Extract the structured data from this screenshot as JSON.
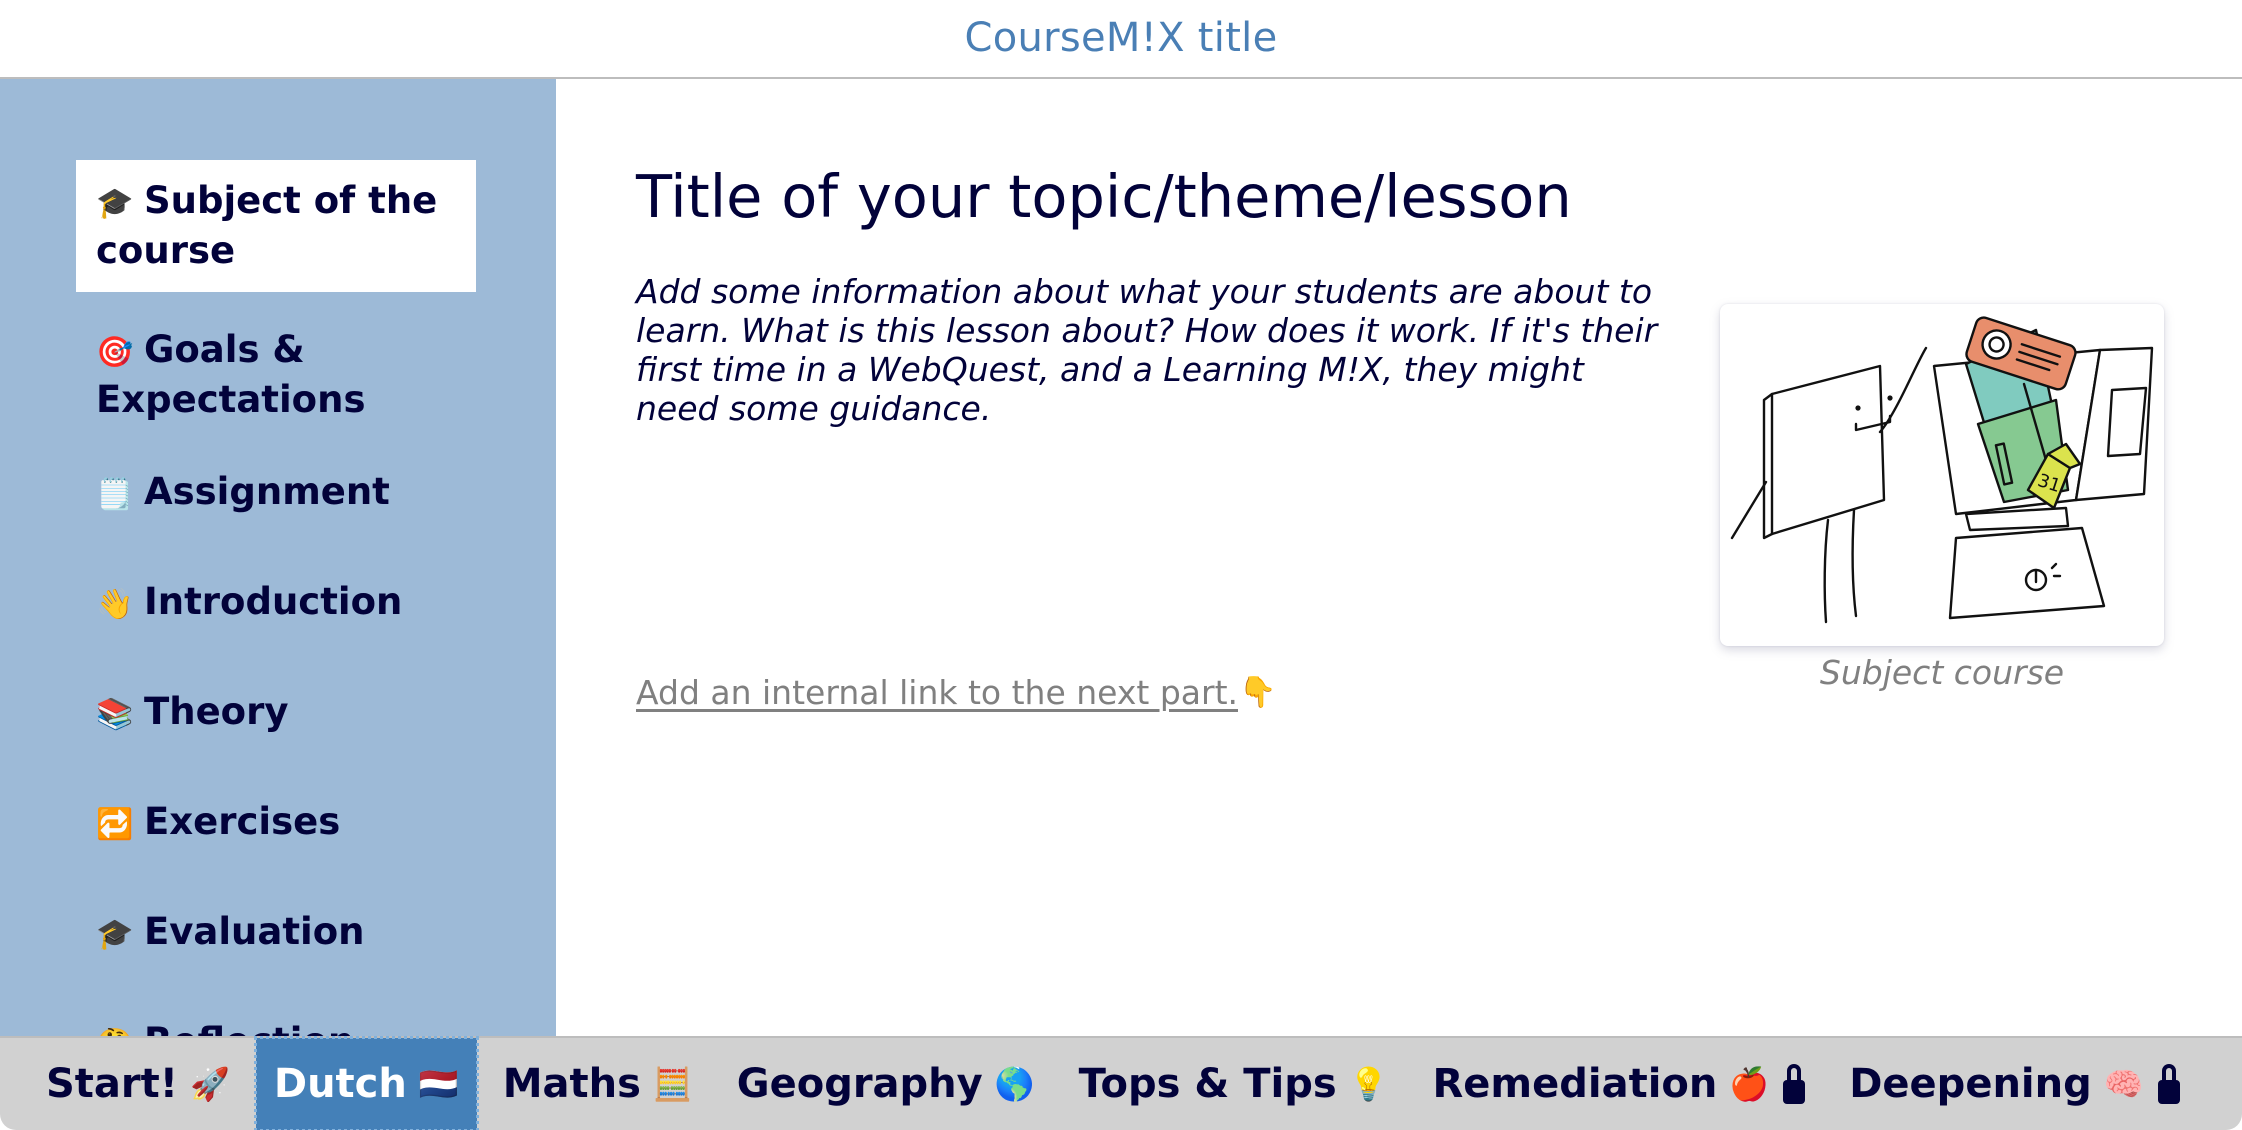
{
  "header": {
    "title": "CourseM!X title"
  },
  "sidebar": {
    "items": [
      {
        "icon": "🎓",
        "icon_name": "graduation-cap-icon",
        "label": "Subject of the course",
        "active": true
      },
      {
        "icon": "🎯",
        "icon_name": "target-icon",
        "label": "Goals & Expectations",
        "active": false
      },
      {
        "icon": "🗒️",
        "icon_name": "notepad-icon",
        "label": "Assignment",
        "active": false
      },
      {
        "icon": "👋",
        "icon_name": "waving-hand-icon",
        "label": "Introduction",
        "active": false
      },
      {
        "icon": "📚",
        "icon_name": "books-icon",
        "label": "Theory",
        "active": false
      },
      {
        "icon": "🔁",
        "icon_name": "repeat-icon",
        "label": "Exercises",
        "active": false
      },
      {
        "icon": "🎓",
        "icon_name": "graduation-cap-icon",
        "label": "Evaluation",
        "active": false
      },
      {
        "icon": "🤔",
        "icon_name": "thinking-face-icon",
        "label": "Reflection",
        "active": false
      }
    ]
  },
  "main": {
    "title": "Title of your topic/theme/lesson",
    "intro": "Add some information about what your students are about to learn. What is this lesson about? How does it work. If it's their first time in a WebQuest, and a Learning M!X, they might need some guidance.",
    "next_link": "Add an internal link to the next part.",
    "next_link_icon": "👇",
    "figure": {
      "caption": "Subject course",
      "alt": "Illustration of a teacher board figure and a blender filled with books, a projector and a calendar"
    }
  },
  "tabs": [
    {
      "label": "Start!",
      "icon": "🚀",
      "icon_name": "rocket-icon",
      "active": false,
      "locked": false
    },
    {
      "label": "Dutch",
      "icon": "🇳🇱",
      "icon_name": "netherlands-flag-icon",
      "active": true,
      "locked": false
    },
    {
      "label": "Maths",
      "icon": "🧮",
      "icon_name": "abacus-icon",
      "active": false,
      "locked": false
    },
    {
      "label": "Geography",
      "icon": "🌎",
      "icon_name": "globe-icon",
      "active": false,
      "locked": false
    },
    {
      "label": "Tops & Tips",
      "icon": "💡",
      "icon_name": "light-bulb-icon",
      "active": false,
      "locked": false
    },
    {
      "label": "Remediation",
      "icon": "🍎",
      "icon_name": "apple-icon",
      "active": false,
      "locked": true
    },
    {
      "label": "Deepening",
      "icon": "🧠",
      "icon_name": "brain-icon",
      "active": false,
      "locked": true
    }
  ],
  "colors": {
    "header_title": "#4a7fb5",
    "sidebar_bg": "#9dbad7",
    "text_dark": "#02023a",
    "tab_active_bg": "#4480b8",
    "tabbar_bg": "#d1d1d1",
    "link_gray": "#808080"
  }
}
